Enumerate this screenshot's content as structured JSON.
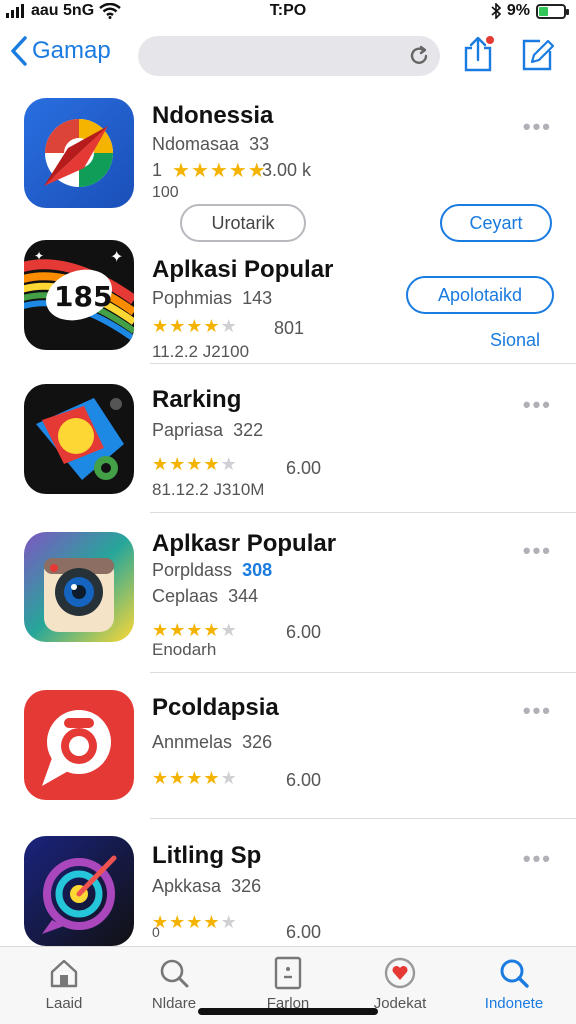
{
  "status_bar": {
    "carrier": "aau 5nG",
    "time": "T:PO",
    "battery": "9%",
    "battery_level": 0.3
  },
  "nav": {
    "back_label": "Gamap",
    "search_placeholder": "",
    "icons": [
      "back-chevron-icon",
      "refresh-icon",
      "share-icon",
      "edit-icon"
    ]
  },
  "apps": [
    {
      "name": "Ndonessia",
      "subtitle": "Ndomasaa",
      "subtitle_num": "33",
      "rating_count": "1",
      "stars": 5,
      "rating_value": "3.00 k",
      "meta": "100",
      "secondary_button": "Urotarik",
      "primary_button": "Ceyart"
    },
    {
      "name": "Aplkasi Popular",
      "subtitle": "Pophmias",
      "subtitle_num": "143",
      "stars": 3.5,
      "rating_value": "801",
      "meta": "11.2.2 J2100",
      "primary_button": "Apolotaikd",
      "link_text": "Sional"
    },
    {
      "name": "Rarking",
      "subtitle": "Papriasa",
      "subtitle_num": "322",
      "stars": 3.5,
      "rating_value": "6.00",
      "meta": "81.12.2 J310M"
    },
    {
      "name": "Aplkasr Popular",
      "subtitle": "Porpldass",
      "subtitle_num": "308",
      "subtitle2": "Ceplaas",
      "subtitle2_num": "344",
      "stars": 3.5,
      "rating_value": "6.00",
      "meta": "Enodarh"
    },
    {
      "name": "Pcoldapsia",
      "subtitle": "Annmelas",
      "subtitle_num": "326",
      "stars": 3.5,
      "rating_value": "6.00"
    },
    {
      "name": "Litling Sp",
      "subtitle": "Apkkasa",
      "subtitle_num": "326",
      "stars": 3.5,
      "rating_value": "6.00",
      "meta": "0"
    }
  ],
  "tabs": [
    {
      "label": "Laaid",
      "icon": "home-icon"
    },
    {
      "label": "Nldare",
      "icon": "search-icon"
    },
    {
      "label": "Farlon",
      "icon": "card-icon"
    },
    {
      "label": "Jodekat",
      "icon": "heart-shield-icon"
    },
    {
      "label": "Indonete",
      "icon": "search-icon",
      "active": true
    }
  ],
  "colors": {
    "accent": "#1a7be0",
    "star": "#f5b301"
  }
}
